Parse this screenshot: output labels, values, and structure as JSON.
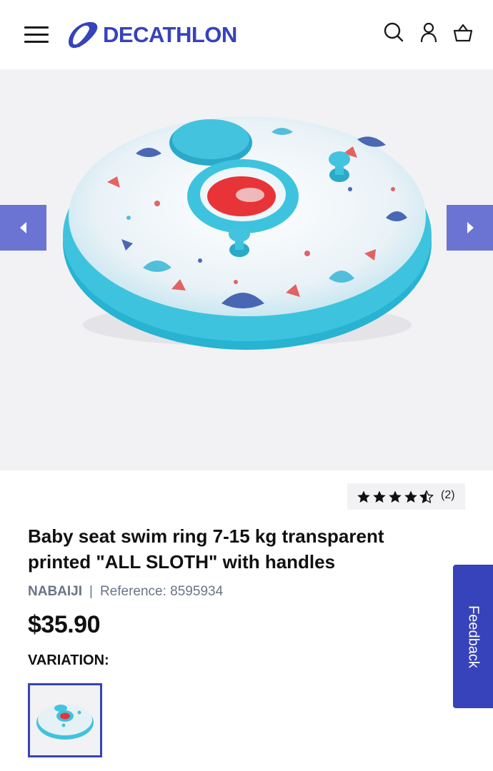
{
  "header": {
    "menu_icon": "hamburger-menu-icon",
    "logo_text": "DECATHLON",
    "brand_color": "#3643ba",
    "icons": [
      "search-icon",
      "account-icon",
      "cart-icon"
    ]
  },
  "gallery": {
    "prev_icon": "chevron-left-icon",
    "next_icon": "chevron-right-icon",
    "arrow_color": "#6b74d3",
    "background": "#f2f2f4"
  },
  "rating": {
    "score": 4.5,
    "max": 5,
    "count_label": "(2)"
  },
  "product": {
    "title": "Baby seat swim ring 7-15 kg transparent printed \"ALL SLOTH\" with handles",
    "brand": "NABAIJI",
    "separator": "|",
    "reference": "Reference: 8595934",
    "price": "$35.90",
    "variation_label": "VARIATION:"
  },
  "feedback": {
    "label": "Feedback"
  }
}
